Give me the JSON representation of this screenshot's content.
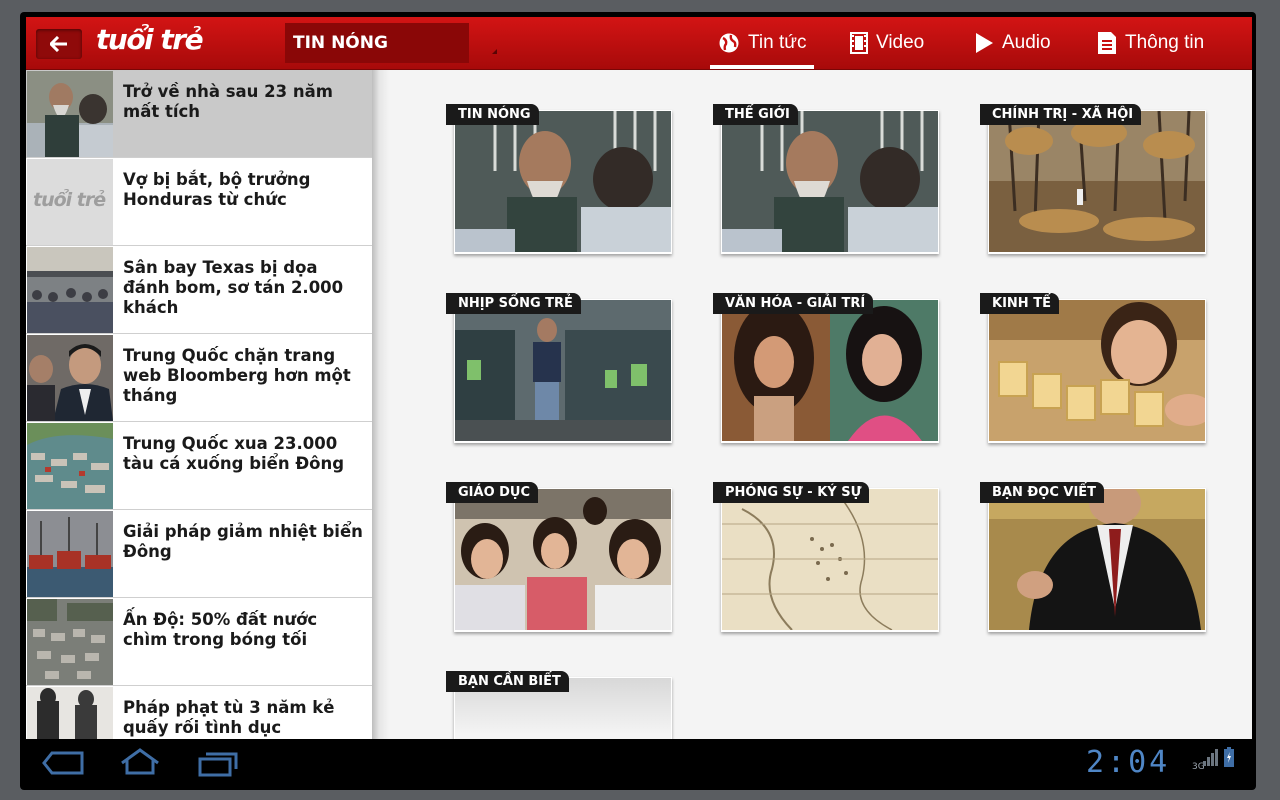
{
  "header": {
    "logo": "tuổi trẻ",
    "section": "TIN NÓNG",
    "tabs": [
      {
        "label": "Tin tức",
        "icon": "globe-icon"
      },
      {
        "label": "Video",
        "icon": "film-icon"
      },
      {
        "label": "Audio",
        "icon": "play-icon"
      },
      {
        "label": "Thông tin",
        "icon": "document-icon"
      }
    ]
  },
  "articles": [
    {
      "title": " Trở về nhà sau 23 năm mất tích"
    },
    {
      "title": "Vợ bị bắt, bộ trưởng Honduras từ chức",
      "thumb_text": "tuổi trẻ"
    },
    {
      "title": "Sân bay Texas bị dọa đánh bom, sơ tán 2.000 khách"
    },
    {
      "title": "Trung Quốc chặn trang web Bloomberg hơn một tháng"
    },
    {
      "title": "Trung Quốc xua 23.000 tàu cá xuống biển Đông"
    },
    {
      "title": "Giải pháp giảm nhiệt biển Đông"
    },
    {
      "title": "Ấn Độ: 50% đất nước chìm trong bóng tối"
    },
    {
      "title": "Pháp phạt tù 3 năm kẻ quấy rối tình dục"
    }
  ],
  "categories": [
    {
      "label": "TIN NÓNG"
    },
    {
      "label": "THẾ GIỚI"
    },
    {
      "label": "CHÍNH TRỊ - XÃ HỘI"
    },
    {
      "label": "NHỊP SỐNG TRẺ"
    },
    {
      "label": "VĂN HÓA - GIẢI TRÍ"
    },
    {
      "label": "KINH TẾ"
    },
    {
      "label": "GIÁO DỤC"
    },
    {
      "label": "PHÓNG SỰ - KÝ SỰ"
    },
    {
      "label": "BẠN ĐỌC VIẾT"
    },
    {
      "label": "BẠN CẦN BIẾT"
    }
  ],
  "system": {
    "clock": "2:04",
    "network": "3G"
  },
  "colors": {
    "brand_red": "#c81010",
    "clock_blue": "#4f86c6"
  }
}
